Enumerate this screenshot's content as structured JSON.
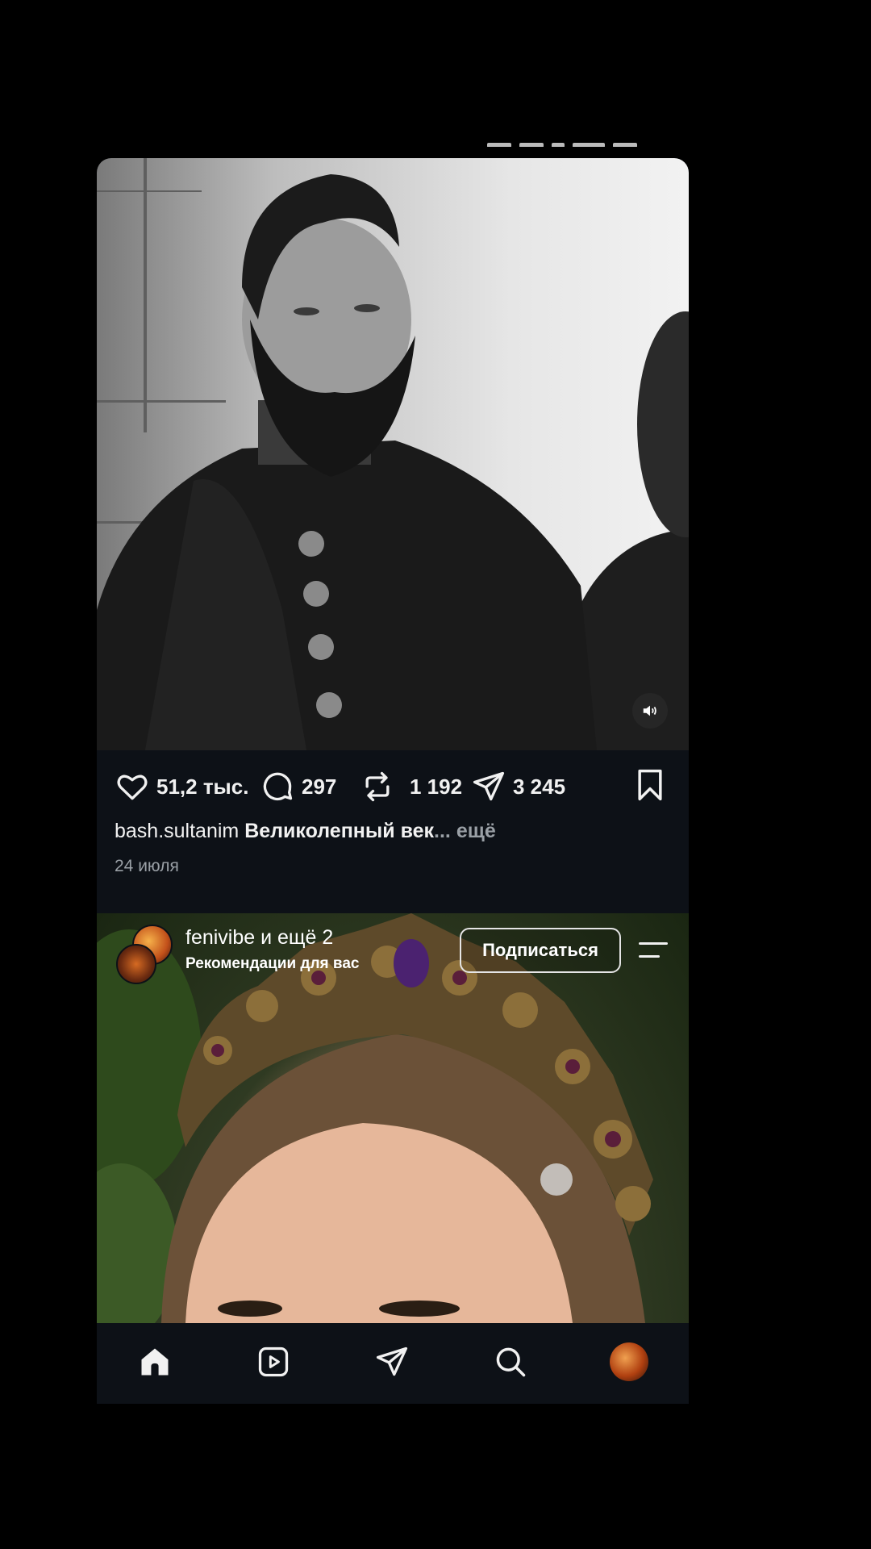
{
  "post1": {
    "likes": "51,2 тыс.",
    "comments": "297",
    "reposts": "1 192",
    "shares": "3 245",
    "username": "bash.sultanim",
    "caption_text": "Великолепный век",
    "caption_ellipsis": "...",
    "more_label": "ещё",
    "date": "24 июля"
  },
  "post2": {
    "username_line": "fenivibe и ещё 2",
    "subtitle": "Рекомендации для вас",
    "follow_label": "Подписаться"
  },
  "icons": {
    "like": "heart-icon",
    "comment": "comment-icon",
    "repost": "repost-icon",
    "share": "send-icon",
    "save": "bookmark-icon",
    "sound": "speaker-icon",
    "menu": "menu-icon",
    "nav": [
      "home-icon",
      "reels-icon",
      "direct-icon",
      "search-icon",
      "profile-avatar"
    ]
  },
  "colors": {
    "background": "#0d1117",
    "text": "#f1f1f1",
    "muted": "#9aa0a6"
  }
}
